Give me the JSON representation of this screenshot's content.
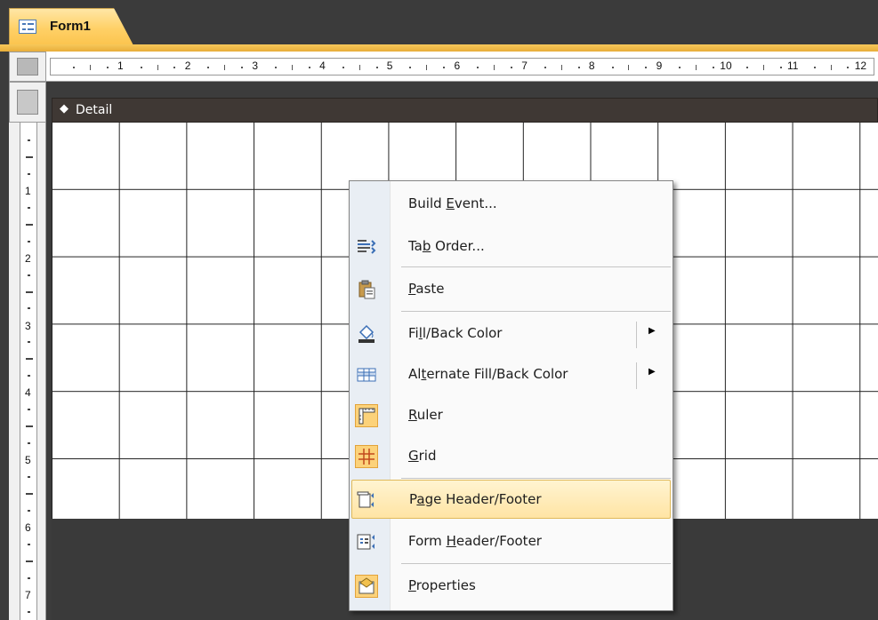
{
  "tab": {
    "label": "Form1"
  },
  "ruler": {
    "marks": [
      "1",
      "2",
      "3",
      "4",
      "5",
      "6",
      "7",
      "8",
      "9",
      "10",
      "11",
      "12"
    ]
  },
  "vruler": {
    "marks": [
      "1",
      "2",
      "3",
      "4",
      "5",
      "6",
      "7"
    ]
  },
  "section": {
    "label": "Detail"
  },
  "context_menu": {
    "items": [
      {
        "label_pre": "Build ",
        "label_u": "E",
        "label_post": "vent...",
        "icon": "none"
      },
      {
        "label_pre": "Ta",
        "label_u": "b",
        "label_post": " Order...",
        "icon": "tab-order-icon"
      },
      {
        "label_pre": "",
        "label_u": "P",
        "label_post": "aste",
        "icon": "paste-icon"
      },
      {
        "label_pre": "Fi",
        "label_u": "l",
        "label_post": "l/Back Color",
        "icon": "fill-color-icon",
        "submenu": true
      },
      {
        "label_pre": "Al",
        "label_u": "t",
        "label_post": "ernate Fill/Back Color",
        "icon": "alternate-fill-icon",
        "submenu": true
      },
      {
        "label_pre": "",
        "label_u": "R",
        "label_post": "uler",
        "icon": "ruler-icon",
        "checked": true
      },
      {
        "label_pre": "",
        "label_u": "G",
        "label_post": "rid",
        "icon": "grid-icon",
        "checked": true
      },
      {
        "label_pre": "P",
        "label_u": "a",
        "label_post": "ge Header/Footer",
        "icon": "page-header-footer-icon",
        "highlighted": true
      },
      {
        "label_pre": "Form ",
        "label_u": "H",
        "label_post": "eader/Footer",
        "icon": "form-header-footer-icon"
      },
      {
        "label_pre": "",
        "label_u": "P",
        "label_post": "roperties",
        "icon": "properties-icon"
      }
    ],
    "submenu_glyph": "▶"
  },
  "colors": {
    "tab_accent": "#f7c85a",
    "section_bar": "#3f3834",
    "menu_highlight": "#ffe4a4",
    "background": "#3c3c3c"
  }
}
